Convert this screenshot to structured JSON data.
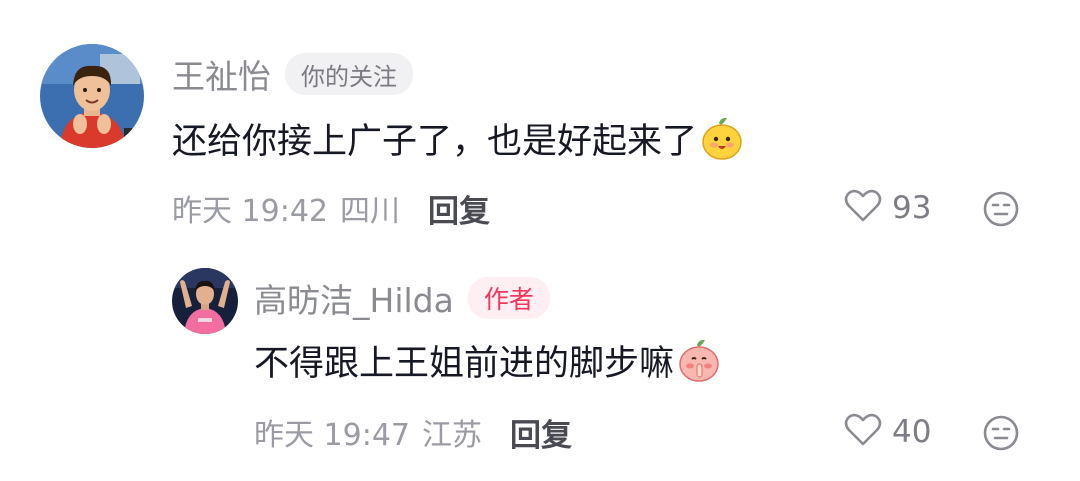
{
  "comments": [
    {
      "username": "王祉怡",
      "badge": "你的关注",
      "text": "还给你接上广子了，也是好起来了",
      "emoji": "mango-face-emoji",
      "time": "昨天 19:42",
      "location": "四川",
      "reply_label": "回复",
      "likes": "93"
    },
    {
      "username": "高昉洁_Hilda",
      "badge": "作者",
      "text": "不得跟上王姐前进的脚步嘛",
      "emoji": "peach-shush-emoji",
      "time": "昨天 19:47",
      "location": "江苏",
      "reply_label": "回复",
      "likes": "40"
    }
  ],
  "colors": {
    "username": "#8a8b91",
    "meta": "#9b9ca3",
    "author_badge_text": "#f3365a",
    "author_badge_bg": "#fdeff2",
    "follow_badge_bg": "#f1f1f3"
  },
  "icons": {
    "like": "heart-outline-icon",
    "dislike": "neutral-face-icon"
  }
}
